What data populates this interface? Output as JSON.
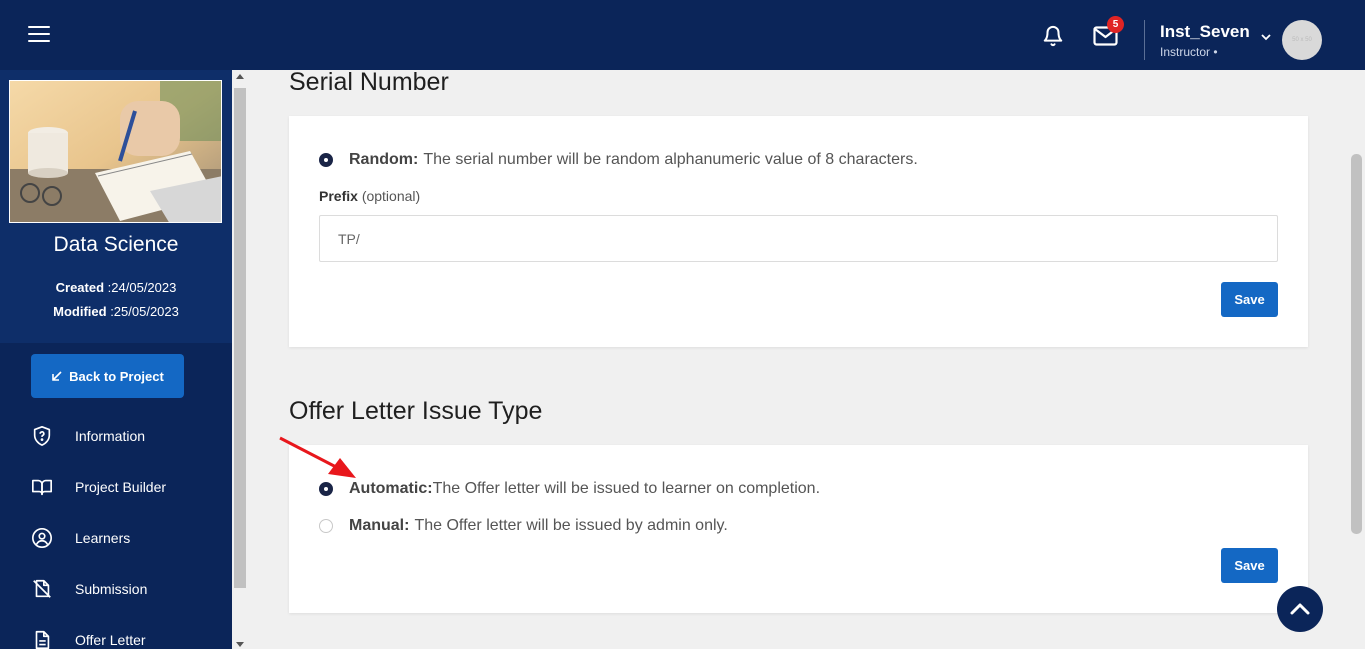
{
  "header": {
    "notification_count": "5",
    "user_name": "Inst_Seven",
    "user_role": "Instructor •",
    "avatar_text": "50 x 50",
    "bg_color": "#0b2559"
  },
  "sidebar": {
    "course_title": "Data Science",
    "created_label": "Created",
    "created_value": ":24/05/2023",
    "modified_label": "Modified",
    "modified_value": ":25/05/2023",
    "back_button": "Back to Project",
    "items": [
      {
        "label": "Information",
        "icon": "shield-question-icon"
      },
      {
        "label": "Project Builder",
        "icon": "open-book-icon"
      },
      {
        "label": "Learners",
        "icon": "user-circle-icon"
      },
      {
        "label": "Submission",
        "icon": "file-off-icon"
      },
      {
        "label": "Offer Letter",
        "icon": "document-icon"
      }
    ]
  },
  "serial": {
    "title": "Serial Number",
    "random_label": "Random:",
    "random_text": "The serial number will be random alphanumeric value of 8 characters.",
    "prefix_label": "Prefix",
    "prefix_hint": "(optional)",
    "prefix_value": "TP/",
    "save_label": "Save"
  },
  "offer": {
    "title": "Offer Letter Issue Type",
    "automatic_label": "Automatic:",
    "automatic_text": "The Offer letter will be issued to learner on completion.",
    "manual_label": "Manual:",
    "manual_text": "The Offer letter will be issued by admin only.",
    "selected": "automatic",
    "save_label": "Save"
  },
  "colors": {
    "primary_button": "#1468c4",
    "radio_selected": "#1a2547",
    "annotation_arrow": "#e8171c"
  }
}
